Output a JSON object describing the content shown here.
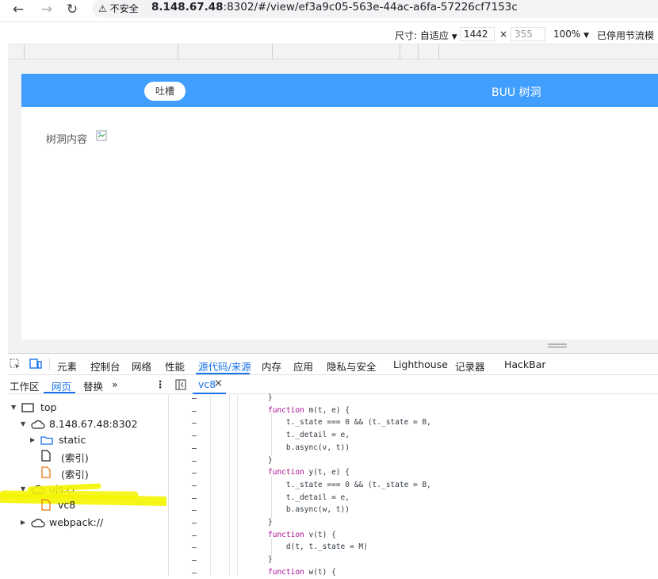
{
  "browser": {
    "back_icon": "arrow-left-icon",
    "forward_icon": "arrow-right-icon",
    "reload_icon": "reload-icon",
    "insecure_label": "⚠ 不安全",
    "url_host": "8.148.67.48",
    "url_rest": ":8302/#/view/ef3a9c05-563e-44ac-a6fa-57226cf7153c"
  },
  "device_toolbar": {
    "size_label": "尺寸: 自适应",
    "width": "1442",
    "times": "×",
    "height": "355",
    "zoom": "100%",
    "throttle": "已停用节流模式"
  },
  "site": {
    "tucao_button": "吐槽",
    "title": "BUU 树洞",
    "content_label": "树洞内容",
    "header_color": "#409eff"
  },
  "devtools": {
    "tabs": [
      "元素",
      "控制台",
      "网络",
      "性能",
      "源代码/来源",
      "内存",
      "应用",
      "隐私与安全",
      "Lighthouse",
      "记录器",
      "HackBar"
    ],
    "active_tab": "源代码/来源",
    "nav_tabs": [
      "工作区",
      "网页",
      "替换"
    ],
    "more": "»",
    "open_file": "vc8",
    "close": "×",
    "tree": {
      "top": "top",
      "host": "8.148.67.48:8302",
      "static": "static",
      "index1": "(索引)",
      "index2": "(索引)",
      "ujs": "ujs.ci",
      "vc8": "vc8",
      "webpack": "webpack://"
    },
    "code": [
      "}",
      "function m(t, e) {",
      "    t._state === 0 && (t._state = B,",
      "    t._detail = e,",
      "    b.async(v, t))",
      "}",
      "function y(t, e) {",
      "    t._state === 0 && (t._state = B,",
      "    t._detail = e,",
      "    b.async(w, t))",
      "}",
      "function v(t) {",
      "    d(t, t._state = M)",
      "}",
      "function w(t) {"
    ],
    "gutter_marks": [
      "-",
      "-",
      "-",
      "-",
      "-",
      "-",
      "-",
      "-",
      "-",
      "-",
      "-",
      "-",
      "-",
      "-",
      "-"
    ],
    "highlight_color": "#f5f500"
  }
}
